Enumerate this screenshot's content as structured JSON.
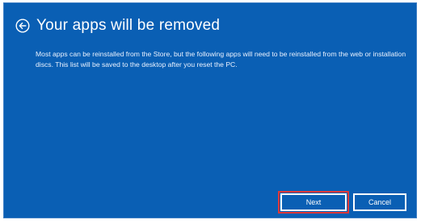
{
  "dialog": {
    "title": "Your apps will be removed",
    "message": "Most apps can be reinstalled from the Store, but the following apps will need to be reinstalled from the web or installation discs. This list will be saved to the desktop after you reset the PC.",
    "back_icon": "back-arrow-icon"
  },
  "buttons": {
    "next_label": "Next",
    "cancel_label": "Cancel"
  },
  "colors": {
    "background": "#0a5fb4",
    "text": "#ffffff",
    "focus_outline": "#e03838"
  }
}
